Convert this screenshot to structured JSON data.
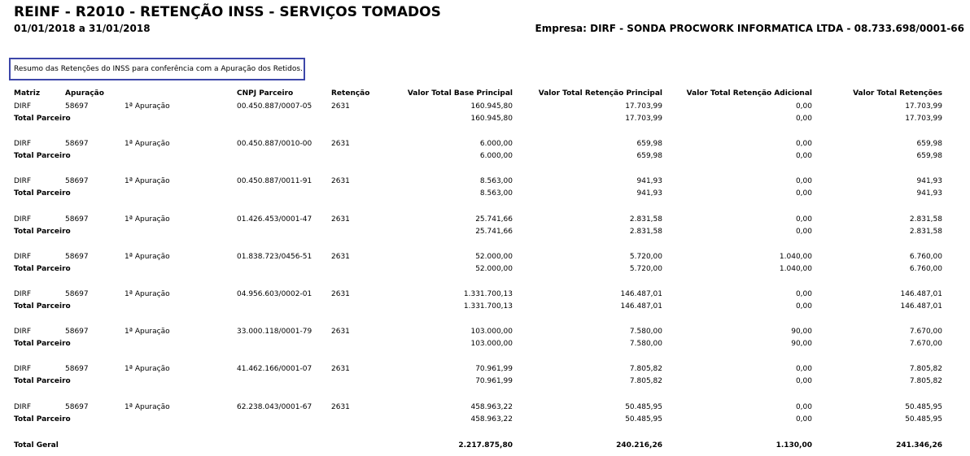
{
  "header": {
    "title": "REINF - R2010 - RETENÇÃO INSS - SERVIÇOS TOMADOS",
    "period": "01/01/2018 a 31/01/2018",
    "company": "Empresa: DIRF - SONDA PROCWORK INFORMATICA LTDA - 08.733.698/0001-66"
  },
  "note": "Resumo das Retenções do INSS para conferência com a Apuração dos Retidos.",
  "columns": {
    "matriz": "Matriz",
    "apuracao": "Apuração",
    "cnpj": "CNPJ Parceiro",
    "retencao": "Retenção",
    "base": "Valor Total Base Principal",
    "ret_principal": "Valor Total Retenção Principal",
    "ret_adicional": "Valor Total Retenção Adicional",
    "ret_total": "Valor Total Retenções"
  },
  "subtotal_label": "Total Parceiro",
  "groups": [
    {
      "matriz": "DIRF",
      "apuracao": "58697",
      "tipo": "1ª Apuração",
      "cnpj": "00.450.887/0007-05",
      "retencao": "2631",
      "base": "160.945,80",
      "ret_principal": "17.703,99",
      "ret_adicional": "0,00",
      "ret_total": "17.703,99"
    },
    {
      "matriz": "DIRF",
      "apuracao": "58697",
      "tipo": "1ª Apuração",
      "cnpj": "00.450.887/0010-00",
      "retencao": "2631",
      "base": "6.000,00",
      "ret_principal": "659,98",
      "ret_adicional": "0,00",
      "ret_total": "659,98"
    },
    {
      "matriz": "DIRF",
      "apuracao": "58697",
      "tipo": "1ª Apuração",
      "cnpj": "00.450.887/0011-91",
      "retencao": "2631",
      "base": "8.563,00",
      "ret_principal": "941,93",
      "ret_adicional": "0,00",
      "ret_total": "941,93"
    },
    {
      "matriz": "DIRF",
      "apuracao": "58697",
      "tipo": "1ª Apuração",
      "cnpj": "01.426.453/0001-47",
      "retencao": "2631",
      "base": "25.741,66",
      "ret_principal": "2.831,58",
      "ret_adicional": "0,00",
      "ret_total": "2.831,58"
    },
    {
      "matriz": "DIRF",
      "apuracao": "58697",
      "tipo": "1ª Apuração",
      "cnpj": "01.838.723/0456-51",
      "retencao": "2631",
      "base": "52.000,00",
      "ret_principal": "5.720,00",
      "ret_adicional": "1.040,00",
      "ret_total": "6.760,00"
    },
    {
      "matriz": "DIRF",
      "apuracao": "58697",
      "tipo": "1ª Apuração",
      "cnpj": "04.956.603/0002-01",
      "retencao": "2631",
      "base": "1.331.700,13",
      "ret_principal": "146.487,01",
      "ret_adicional": "0,00",
      "ret_total": "146.487,01"
    },
    {
      "matriz": "DIRF",
      "apuracao": "58697",
      "tipo": "1ª Apuração",
      "cnpj": "33.000.118/0001-79",
      "retencao": "2631",
      "base": "103.000,00",
      "ret_principal": "7.580,00",
      "ret_adicional": "90,00",
      "ret_total": "7.670,00"
    },
    {
      "matriz": "DIRF",
      "apuracao": "58697",
      "tipo": "1ª Apuração",
      "cnpj": "41.462.166/0001-07",
      "retencao": "2631",
      "base": "70.961,99",
      "ret_principal": "7.805,82",
      "ret_adicional": "0,00",
      "ret_total": "7.805,82"
    },
    {
      "matriz": "DIRF",
      "apuracao": "58697",
      "tipo": "1ª Apuração",
      "cnpj": "62.238.043/0001-67",
      "retencao": "2631",
      "base": "458.963,22",
      "ret_principal": "50.485,95",
      "ret_adicional": "0,00",
      "ret_total": "50.485,95"
    }
  ],
  "total_geral": {
    "label": "Total Geral",
    "base": "2.217.875,80",
    "ret_principal": "240.216,26",
    "ret_adicional": "1.130,00",
    "ret_total": "241.346,26"
  }
}
